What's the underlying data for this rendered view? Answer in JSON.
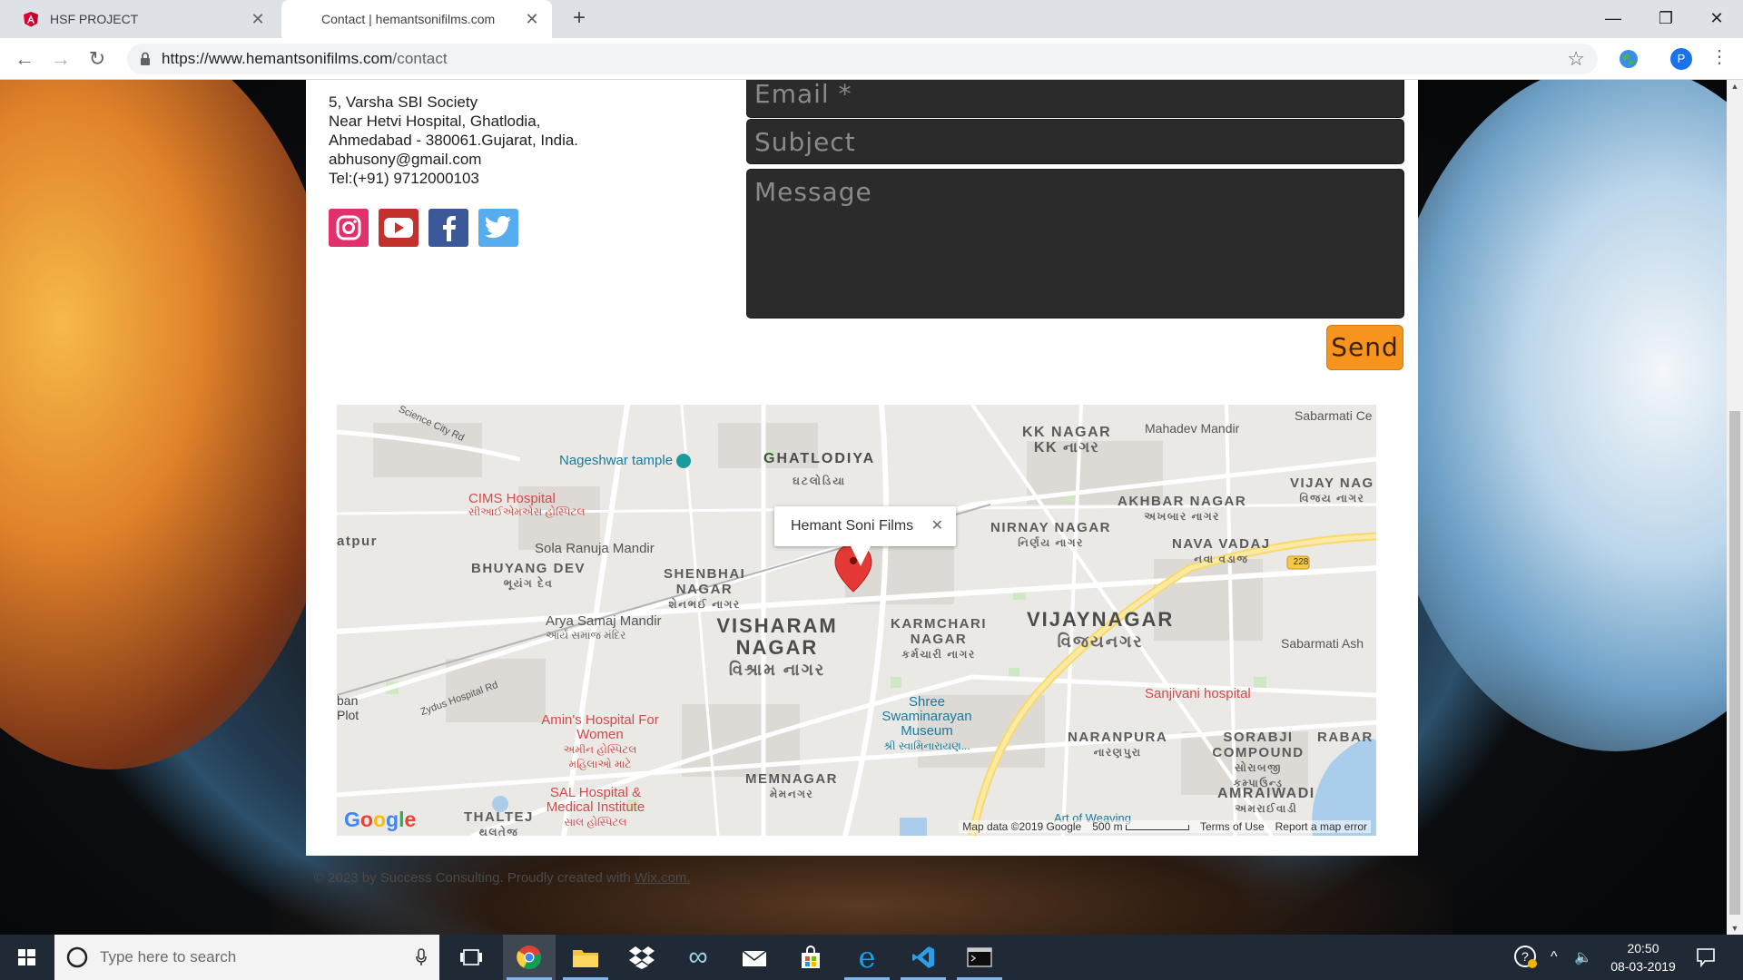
{
  "browser": {
    "tabs": [
      {
        "title": "HSF PROJECT",
        "icon": "angular-icon"
      },
      {
        "title": "Contact | hemantsonifilms.com",
        "icon": "none"
      }
    ],
    "url_host": "https://www.hemantsonifilms.com",
    "url_path": "/contact",
    "profile_initial": "P"
  },
  "contact": {
    "address_lines": [
      "5, Varsha SBI Society",
      "Near Hetvi Hospital, Ghatlodia,",
      "Ahmedabad - 380061.Gujarat, India.",
      "abhusony@gmail.com",
      "Tel:(+91) 9712000103"
    ],
    "social": [
      "instagram-icon",
      "youtube-icon",
      "facebook-icon",
      "twitter-icon"
    ]
  },
  "form": {
    "email_placeholder": "Email *",
    "subject_placeholder": "Subject",
    "message_placeholder": "Message",
    "send_label": "Send"
  },
  "map": {
    "info_title": "Hemant Soni Films",
    "labels": {
      "sola": "Sola Ranuja Mandir",
      "nageshwar": "Nageshwar tample",
      "ghatlodiya": "GHATLODIYA",
      "ghatlodiya_g": "ઘટલોડિયા",
      "kknagar": "KK NAGAR",
      "kknagar_g": "KK નાગર",
      "mahadev": "Mahadev Mandir",
      "sabarmati": "Sabarmati Ce",
      "sciencecity": "Science City Rd",
      "cims": "CIMS Hospital",
      "cims_g": "સીઆઈએમએસ હોસ્પિટલ",
      "vijaynag": "VIJAY NAG",
      "vijaynag_g": "વિજય નાગર",
      "akhbar": "AKHBAR NAGAR",
      "akhbar_g": "અખબાર નાગર",
      "nirnay": "NIRNAY NAGAR",
      "nirnay_g": "નિર્ણય નાગર",
      "navavadaj": "NAVA VADAJ",
      "navavadaj_g": "નવા વડાજ",
      "atpur": "atpur",
      "bhuyang": "BHUYANG DEV",
      "bhuyang_g": "ભૂયંગ દેવ",
      "shenbhai": "SHENBHAI NAGAR",
      "shenbhai_g": "શેનભઈ નાગર",
      "arya": "Arya Samaj Mandir",
      "arya_g": "આર્ય સમાજ મંદિર",
      "vishram": "VISHARAM NAGAR",
      "vishram_g": "વિશ્રામ નાગર",
      "karmchari": "KARMCHARI NAGAR",
      "karmchari_g": "કર્મચારી નાગર",
      "vijaynagar": "VIJAYNAGAR",
      "vijaynagar_g": "વિજયનગર",
      "sabarmatiash": "Sabarmati Ash",
      "zydus": "Zydus Hospital Rd",
      "ban": "ban Plot",
      "amins": "Amin's Hospital For Women",
      "amins_g": "અમીન હોસ્પિટલ મહિલાઓ માટે",
      "swaminarayan": "Shree Swaminarayan Museum",
      "swaminarayan_g": "શ્રી સ્વામિનારાયણ...",
      "sanjivani": "Sanjivani hospital",
      "naranpura": "NARANPURA",
      "naranpura_g": "નારણપુરા",
      "sorabji": "SORABJI COMPOUND",
      "sorabji_g": "સોરાબજી કમ્પાઉન્ડ",
      "rabar": "RABAR",
      "memnagar": "MEMNAGAR",
      "memnagar_g": "મેમનગર",
      "sal": "SAL Hospital & Medical Institute",
      "sal_g": "સાલ હોસ્પિટલ",
      "thaltej": "THALTEJ",
      "thaltej_g": "થલતેજ",
      "amraiwadi": "AMRAIWADI",
      "amraiwadi_g": "અમરાઈવાડી",
      "artofweaving": "Art of Weaving",
      "shield": "228"
    },
    "attribution": {
      "data": "Map data ©2019 Google",
      "scale": "500 m",
      "terms": "Terms of Use",
      "report": "Report a map error"
    }
  },
  "footer": {
    "text": "© 2023 by Success Consulting. Proudly created with ",
    "link": "Wix.com."
  },
  "taskbar": {
    "search_placeholder": "Type here to search",
    "time": "20:50",
    "date": "08-03-2019"
  },
  "colors": {
    "send": "#f7941d",
    "instagram": "#e1306c",
    "youtube": "#e52d27",
    "facebook": "#3b5998",
    "twitter": "#55acee",
    "pin": "#e53935"
  }
}
